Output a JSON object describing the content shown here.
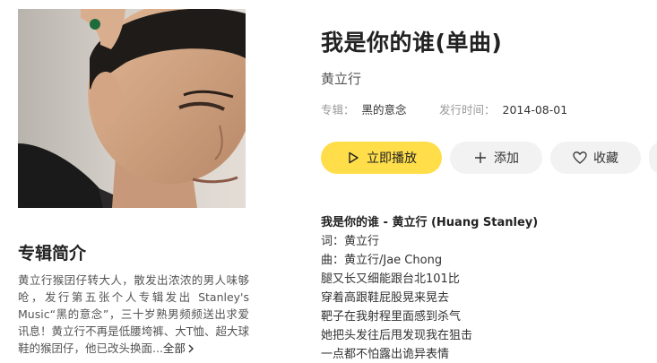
{
  "album": {
    "title": "我是你的谁(单曲)",
    "artist": "黄立行",
    "album_label": "专辑：",
    "album_value": "黑的意念",
    "date_label": "发行时间：",
    "date_value": "2014-08-01"
  },
  "actions": {
    "play_label": "立即播放",
    "add_label": "添加",
    "fav_label": "收藏"
  },
  "intro": {
    "title": "专辑简介",
    "text": "黄立行猴囝仔转大人，散发出浓浓的男人味够呛，发行第五张个人专辑发出 Stanley's Music“黑的意念”，三十岁熟男频频送出求爱讯息！黄立行不再是低腰垮裤、大T恤、超大球鞋的猴囝仔，他已改头换面...",
    "more_label": "全部"
  },
  "lyrics": {
    "heading": "我是你的谁 - 黄立行 (Huang Stanley)",
    "lines": [
      "词：黄立行",
      "曲：黄立行/Jae Chong",
      "腿又长又细能跟台北101比",
      "穿着高跟鞋屁股晃来晃去",
      "靶子在我射程里面感到杀气",
      "她把头发往后甩发现我在狙击",
      "一点都不怕露出诡异表情"
    ]
  },
  "icons": {
    "play": "play-icon",
    "add": "plus-icon",
    "fav": "heart-icon",
    "more_link": "chevron-right-icon"
  },
  "colors": {
    "accent": "#ffde4a",
    "button_gray": "#f2f2f2"
  }
}
